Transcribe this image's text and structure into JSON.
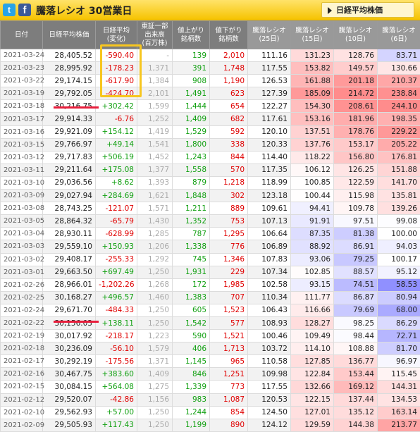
{
  "header": {
    "twitter_glyph": "t",
    "facebook_glyph": "f",
    "title": "騰落レシオ 30営業日",
    "nav_button": "日経平均株価"
  },
  "columns": [
    "日付",
    "日経平均株価",
    "日経平均\n(変化)",
    "東証一部\n出来高\n(百万株)",
    "値上がり\n銘柄数",
    "値下がり\n銘柄数",
    "騰落レシオ\n(25日)",
    "騰落レシオ\n(15日)",
    "騰落レシオ\n(10日)",
    "騰落レシオ\n(6日)"
  ],
  "rows": [
    [
      "2021-03-24",
      "28,405.52",
      "-590.40",
      "-",
      "139",
      "2,010",
      "111.16",
      "131.23",
      "128.76",
      "83.71"
    ],
    [
      "2021-03-23",
      "28,995.92",
      "-178.23",
      "1,371",
      "391",
      "1,748",
      "117.55",
      "153.82",
      "149.57",
      "130.66"
    ],
    [
      "2021-03-22",
      "29,174.15",
      "-617.90",
      "1,384",
      "908",
      "1,190",
      "126.53",
      "161.88",
      "201.18",
      "210.37"
    ],
    [
      "2021-03-19",
      "29,792.05",
      "-424.70",
      "2,101",
      "1,491",
      "623",
      "127.39",
      "185.09",
      "214.72",
      "238.84"
    ],
    [
      "2021-03-18",
      "30,216.75",
      "+302.42",
      "1,599",
      "1,444",
      "654",
      "122.27",
      "154.30",
      "208.61",
      "244.10"
    ],
    [
      "2021-03-17",
      "29,914.33",
      "-6.76",
      "1,252",
      "1,409",
      "682",
      "117.61",
      "153.16",
      "181.96",
      "198.35"
    ],
    [
      "2021-03-16",
      "29,921.09",
      "+154.12",
      "1,419",
      "1,529",
      "592",
      "120.10",
      "137.51",
      "178.76",
      "229.22"
    ],
    [
      "2021-03-15",
      "29,766.97",
      "+49.14",
      "1,541",
      "1,800",
      "338",
      "120.33",
      "137.76",
      "153.17",
      "205.22"
    ],
    [
      "2021-03-12",
      "29,717.83",
      "+506.19",
      "1,452",
      "1,243",
      "844",
      "114.40",
      "118.22",
      "156.80",
      "176.81"
    ],
    [
      "2021-03-11",
      "29,211.64",
      "+175.08",
      "1,377",
      "1,558",
      "570",
      "117.35",
      "106.12",
      "126.25",
      "151.88"
    ],
    [
      "2021-03-10",
      "29,036.56",
      "+8.62",
      "1,393",
      "879",
      "1,218",
      "118.99",
      "100.85",
      "122.59",
      "141.70"
    ],
    [
      "2021-03-09",
      "29,027.94",
      "+284.69",
      "1,621",
      "1,848",
      "302",
      "123.18",
      "100.44",
      "115.98",
      "135.81"
    ],
    [
      "2021-03-08",
      "28,743.25",
      "-121.07",
      "1,571",
      "1,211",
      "889",
      "109.61",
      "94.41",
      "109.78",
      "139.26"
    ],
    [
      "2021-03-05",
      "28,864.32",
      "-65.79",
      "1,430",
      "1,352",
      "753",
      "107.13",
      "91.91",
      "97.51",
      "99.08"
    ],
    [
      "2021-03-04",
      "28,930.11",
      "-628.99",
      "1,285",
      "787",
      "1,295",
      "106.64",
      "87.35",
      "81.38",
      "100.00"
    ],
    [
      "2021-03-03",
      "29,559.10",
      "+150.93",
      "1,206",
      "1,338",
      "776",
      "106.89",
      "88.92",
      "86.91",
      "94.03"
    ],
    [
      "2021-03-02",
      "29,408.17",
      "-255.33",
      "1,292",
      "745",
      "1,346",
      "107.83",
      "93.06",
      "79.25",
      "100.17"
    ],
    [
      "2021-03-01",
      "29,663.50",
      "+697.49",
      "1,250",
      "1,931",
      "229",
      "107.34",
      "102.85",
      "88.57",
      "95.12"
    ],
    [
      "2021-02-26",
      "28,966.01",
      "-1,202.26",
      "1,268",
      "172",
      "1,985",
      "102.58",
      "93.15",
      "74.51",
      "58.53"
    ],
    [
      "2021-02-25",
      "30,168.27",
      "+496.57",
      "1,460",
      "1,383",
      "707",
      "110.34",
      "111.77",
      "86.87",
      "80.94"
    ],
    [
      "2021-02-24",
      "29,671.70",
      "-484.33",
      "1,250",
      "605",
      "1,523",
      "106.43",
      "116.66",
      "79.69",
      "68.00"
    ],
    [
      "2021-02-22",
      "30,156.03",
      "+138.11",
      "1,250",
      "1,542",
      "577",
      "108.93",
      "128.27",
      "98.25",
      "86.29"
    ],
    [
      "2021-02-19",
      "30,017.92",
      "-218.17",
      "1,223",
      "590",
      "1,521",
      "100.46",
      "109.49",
      "98.44",
      "72.71"
    ],
    [
      "2021-02-18",
      "30,236.09",
      "-56.10",
      "1,579",
      "406",
      "1,713",
      "103.72",
      "114.10",
      "108.88",
      "81.70"
    ],
    [
      "2021-02-17",
      "30,292.19",
      "-175.56",
      "1,371",
      "1,145",
      "965",
      "110.58",
      "127.85",
      "136.77",
      "96.97"
    ],
    [
      "2021-02-16",
      "30,467.75",
      "+383.60",
      "1,409",
      "846",
      "1,251",
      "109.98",
      "122.84",
      "153.44",
      "115.45"
    ],
    [
      "2021-02-15",
      "30,084.15",
      "+564.08",
      "1,275",
      "1,339",
      "773",
      "117.55",
      "132.66",
      "169.12",
      "144.31"
    ],
    [
      "2021-02-12",
      "29,520.07",
      "-42.86",
      "1,156",
      "983",
      "1,087",
      "120.53",
      "122.15",
      "137.44",
      "134.53"
    ],
    [
      "2021-02-10",
      "29,562.93",
      "+57.00",
      "1,250",
      "1,244",
      "854",
      "124.50",
      "127.01",
      "135.12",
      "163.14"
    ],
    [
      "2021-02-09",
      "29,505.93",
      "+117.43",
      "1,250",
      "1,199",
      "890",
      "124.12",
      "129.59",
      "144.38",
      "213.77"
    ]
  ],
  "colors": {
    "header_bg": "#7d7d7d",
    "header_bg_ratio": "#999999",
    "up_green": "#11a011",
    "down_red": "#e00000",
    "highlight_box": "#f7c61f",
    "underline_red": "#e81e3c"
  }
}
